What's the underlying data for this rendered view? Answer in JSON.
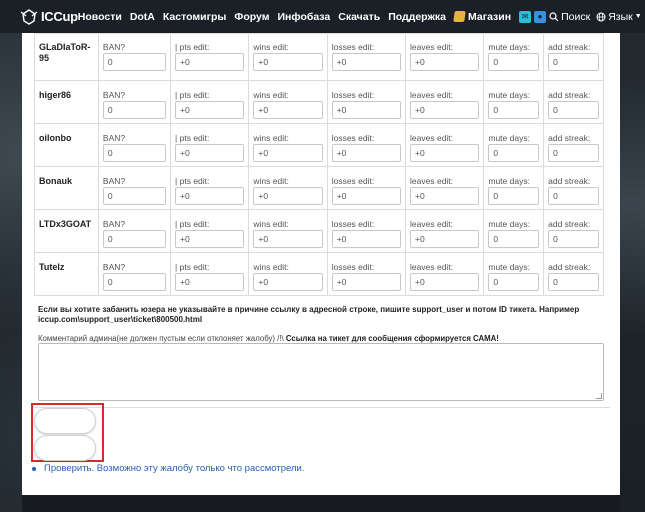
{
  "nav": {
    "logo": "ICCup",
    "items": [
      "Новости",
      "DotA",
      "Кастомигры",
      "Форум",
      "Инфобаза",
      "Скачать",
      "Поддержка"
    ],
    "shop": "Магазин",
    "search": "Поиск",
    "lang": "Язык"
  },
  "field_labels": {
    "ban": "BAN?",
    "pts": "| pts edit:",
    "wins": "wins edit:",
    "losses": "losses edit:",
    "leaves": "leaves edit:",
    "mute": "mute days:",
    "streak": "add streak:"
  },
  "players": [
    {
      "name": "GLaDIaToR-95",
      "ban": "0",
      "pts": "+0",
      "wins": "+0",
      "losses": "+0",
      "leaves": "+0",
      "mute": "0",
      "streak": "0"
    },
    {
      "name": "higer86",
      "ban": "0",
      "pts": "+0",
      "wins": "+0",
      "losses": "+0",
      "leaves": "+0",
      "mute": "0",
      "streak": "0"
    },
    {
      "name": "oilonbo",
      "ban": "0",
      "pts": "+0",
      "wins": "+0",
      "losses": "+0",
      "leaves": "+0",
      "mute": "0",
      "streak": "0"
    },
    {
      "name": "Bonauk",
      "ban": "0",
      "pts": "+0",
      "wins": "+0",
      "losses": "+0",
      "leaves": "+0",
      "mute": "0",
      "streak": "0"
    },
    {
      "name": "LTDx3GOAT",
      "ban": "0",
      "pts": "+0",
      "wins": "+0",
      "losses": "+0",
      "leaves": "+0",
      "mute": "0",
      "streak": "0"
    },
    {
      "name": "Tutelz",
      "ban": "0",
      "pts": "+0",
      "wins": "+0",
      "losses": "+0",
      "leaves": "+0",
      "mute": "0",
      "streak": "0"
    }
  ],
  "note": "Если вы хотите забанить юзера не указывайте в причине ссылку в адресной строке, пишите support_user и потом ID тикета. Например iccup.com\\support_user\\ticket\\800500.html",
  "comment": {
    "label": "Комментарий админа(не должен пустым если отклоняет жалобу) /!\\",
    "label_bold": "Ссылка на тикет для сообщения сформируется САМА!",
    "value": ""
  },
  "status": "Проверить. Возможно эту жалобу только что рассмотрели.",
  "colors": {
    "navbar": "#1b2026",
    "link": "#2a5fb0",
    "highlight": "#d92b2b"
  }
}
